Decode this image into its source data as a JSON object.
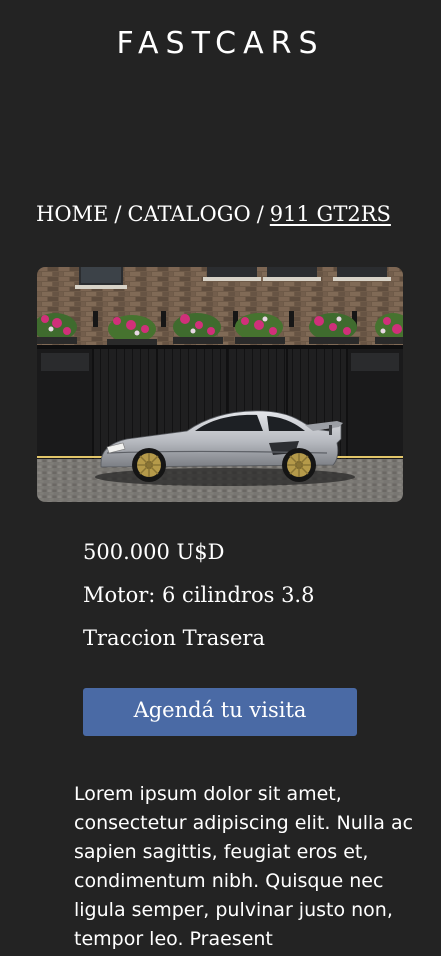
{
  "header": {
    "brand": "FASTCARS"
  },
  "breadcrumb": {
    "home": "HOME",
    "separator": "/",
    "catalog": "CATALOGO",
    "current": "911 GT2RS"
  },
  "product": {
    "image_alt": "Porsche 911 GT2RS silver parked in front of a brick building with flower boxes",
    "specs": [
      "500.000 U$D",
      "Motor: 6 cilindros 3.8",
      "Traccion Trasera"
    ],
    "cta_label": "Agendá tu visita",
    "description": "Lorem ipsum dolor sit amet, consectetur adipiscing elit. Nulla ac sapien sagittis, feugiat eros et, condimentum nibh. Quisque nec ligula semper, pulvinar justo non, tempor leo. Praesent"
  },
  "colors": {
    "background": "#232323",
    "text": "#ffffff",
    "accent": "#4a6aa5"
  }
}
